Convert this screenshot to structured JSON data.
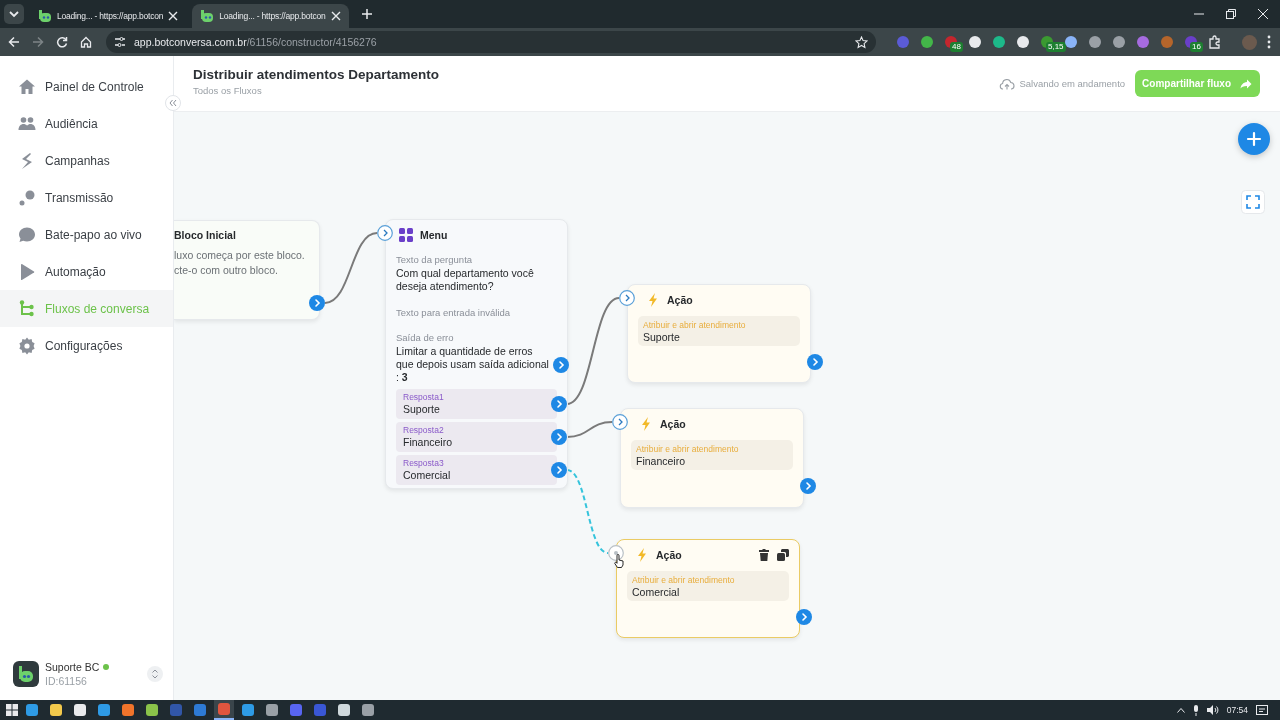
{
  "browser": {
    "tabs": [
      {
        "title": "Loading... - https://app.botcon",
        "selected": false
      },
      {
        "title": "Loading... - https://app.botcon",
        "selected": true
      }
    ],
    "url": {
      "host": "app.botconversa.com.br",
      "path": "/61156/constructor/4156276"
    },
    "extension_badges": [
      "48",
      "5,15",
      "16"
    ]
  },
  "sidebar": {
    "items": [
      {
        "label": "Painel de Controle",
        "selected": false
      },
      {
        "label": "Audiência",
        "selected": false
      },
      {
        "label": "Campanhas",
        "selected": false
      },
      {
        "label": "Transmissão",
        "selected": false
      },
      {
        "label": "Bate-papo ao vivo",
        "selected": false
      },
      {
        "label": "Automação",
        "selected": false
      },
      {
        "label": "Fluxos de conversa",
        "selected": true
      },
      {
        "label": "Configurações",
        "selected": false
      }
    ],
    "account": {
      "name": "Suporte BC",
      "online": true,
      "id": "ID:61156"
    }
  },
  "header": {
    "title": "Distribuir atendimentos Departamento",
    "breadcrumb": "Todos os Fluxos",
    "save_status": "Salvando em andamento",
    "share_button": "Compartilhar fluxo"
  },
  "canvas": {
    "nodes": [
      {
        "kind": "start",
        "title": "Bloco Inicial",
        "lines": [
          "luxo começa por este bloco.",
          "cte-o com outro bloco."
        ],
        "linked": true
      },
      {
        "kind": "menu",
        "title": "Menu",
        "question_label": "Texto da pergunta",
        "question": "Com qual departamento você deseja atendimento?",
        "invalid_label": "Texto para entrada inválida",
        "error_label": "Saída de erro",
        "error_text": "Limitar a quantidade de erros que depois usam saída adicional : **3**",
        "answers": [
          {
            "label": "Resposta1",
            "value": "Suporte",
            "linked": true,
            "dragging": false
          },
          {
            "label": "Resposta2",
            "value": "Financeiro",
            "linked": true,
            "dragging": false
          },
          {
            "label": "Resposta3",
            "value": "Comercial",
            "linked": true,
            "dragging": true
          }
        ]
      },
      {
        "kind": "action",
        "title": "Ação",
        "action_label": "Atribuir e abrir atendimento",
        "value": "Suporte",
        "selected": false
      },
      {
        "kind": "action",
        "title": "Ação",
        "action_label": "Atribuir e abrir atendimento",
        "value": "Financeiro",
        "selected": false
      },
      {
        "kind": "action",
        "title": "Ação",
        "action_label": "Atribuir e abrir atendimento",
        "value": "Comercial",
        "selected": true
      }
    ]
  },
  "taskbar": {
    "time": "07:54"
  }
}
